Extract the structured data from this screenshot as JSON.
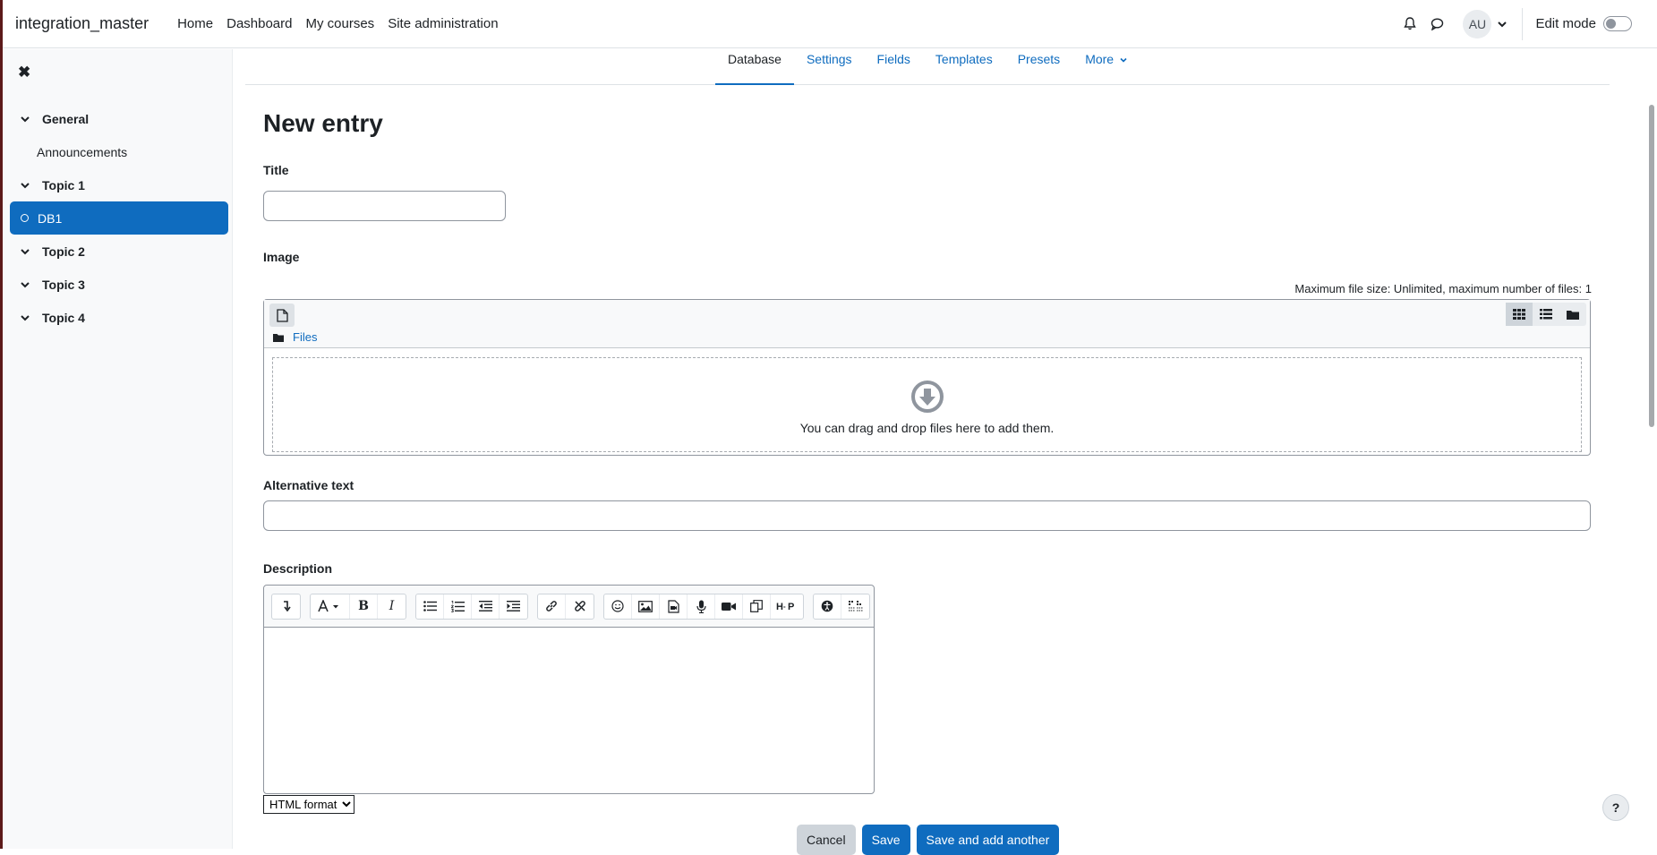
{
  "header": {
    "site_name": "integration_master",
    "nav": [
      "Home",
      "Dashboard",
      "My courses",
      "Site administration"
    ],
    "avatar_initials": "AU",
    "edit_mode_label": "Edit mode"
  },
  "course_index": {
    "general": "General",
    "announcements": "Announcements",
    "topic1": "Topic 1",
    "active_activity": "DB1",
    "topic2": "Topic 2",
    "topic3": "Topic 3",
    "topic4": "Topic 4"
  },
  "secondary_nav": {
    "tabs": [
      "Database",
      "Settings",
      "Fields",
      "Templates",
      "Presets",
      "More"
    ],
    "active": "Database"
  },
  "form": {
    "heading": "New entry",
    "title_label": "Title",
    "title_value": "",
    "image_label": "Image",
    "max_file_info": "Maximum file size: Unlimited, maximum number of files: 1",
    "files_link": "Files",
    "drop_message": "You can drag and drop files here to add them.",
    "alt_text_label": "Alternative text",
    "alt_text_value": "",
    "description_label": "Description",
    "format_selected": "HTML format",
    "cancel": "Cancel",
    "save": "Save",
    "save_and_add": "Save and add another"
  },
  "help": "?",
  "colors": {
    "primary": "#0f6cbf",
    "text": "#1d2125",
    "border": "#8f959e"
  }
}
